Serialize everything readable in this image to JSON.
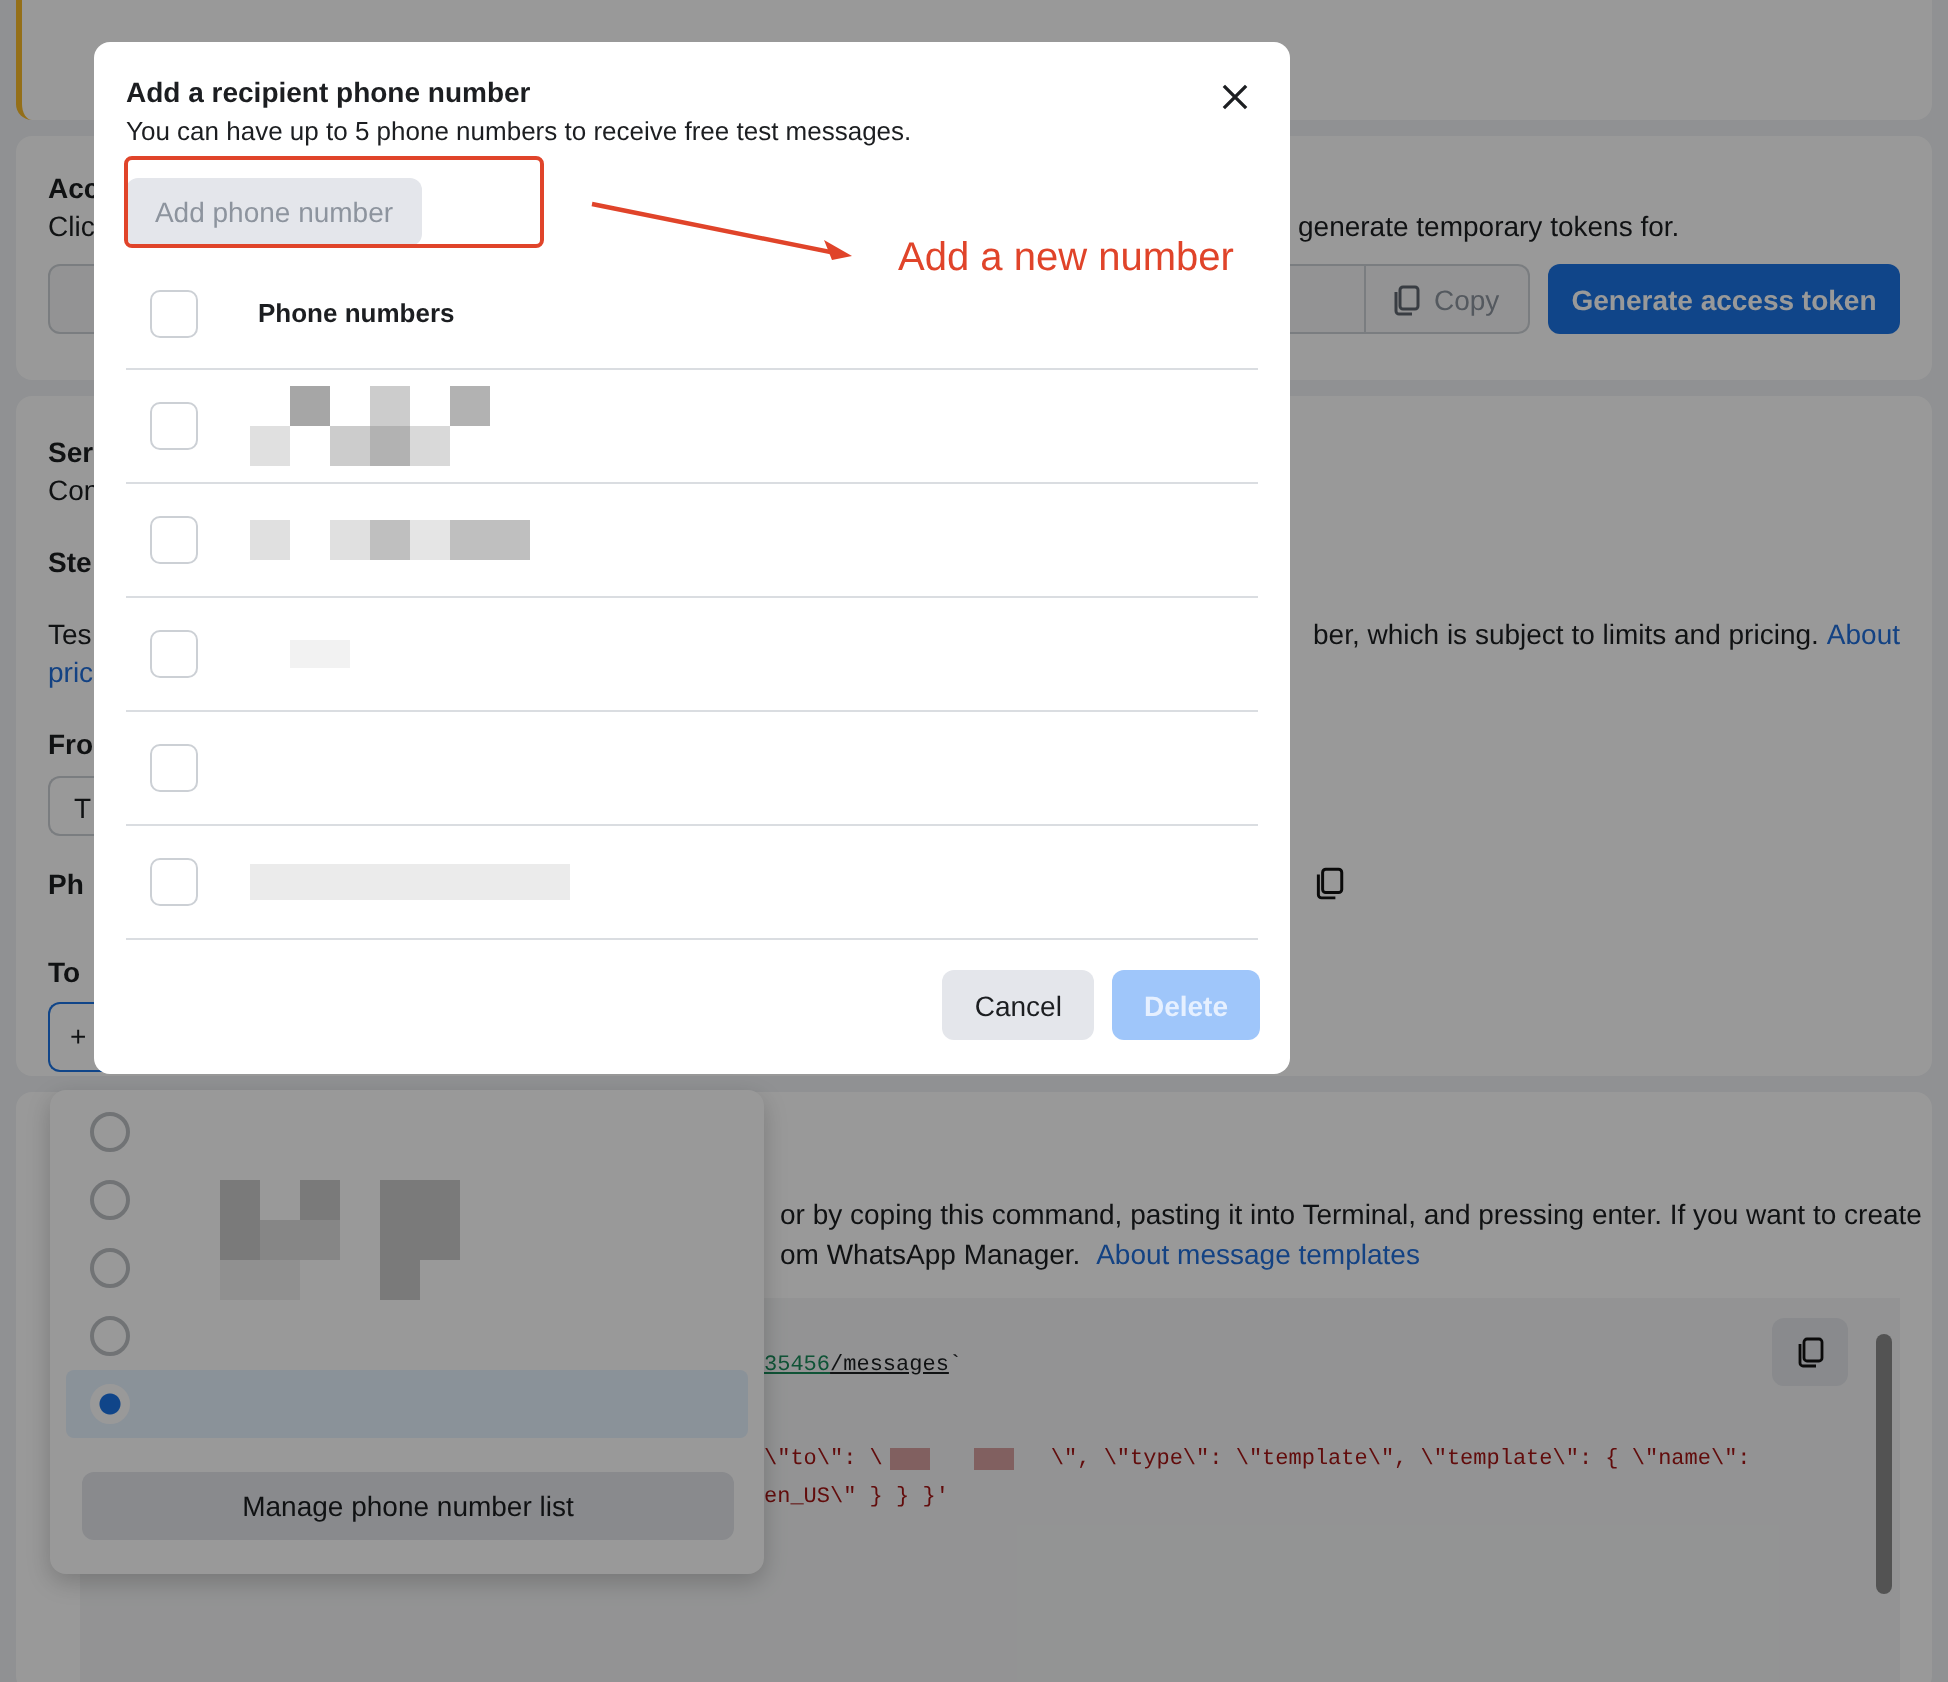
{
  "access_card": {
    "title": "Acc",
    "description_start": "Clic",
    "description_end": "generate temporary tokens for.",
    "copy_button": "Copy",
    "generate_button": "Generate access token"
  },
  "send_card": {
    "title": "Ser",
    "subtitle": "Con",
    "step": "Ste",
    "text_start": "Tes",
    "text_end": "ber, which is subject to limits and pricing.",
    "link": "About",
    "link_continued": "pric",
    "from_label": "Fro",
    "from_value": "T",
    "phone_label": "Ph",
    "to_label": "To",
    "to_value": "+"
  },
  "command_card": {
    "line_1": "or by coping this command, pasting it into Terminal, and pressing enter. If you want to create",
    "line_2": "om WhatsApp Manager.",
    "link": "About message templates",
    "code_lines": [
      {
        "parts": [
          {
            "kind": "url",
            "text": "35456"
          },
          {
            "kind": "path",
            "text": "/messages"
          },
          {
            "kind": "plain",
            "text": " `"
          }
        ]
      },
      {
        "parts": [
          {
            "kind": "string",
            "text": "\\\"to\\\": \\"
          },
          {
            "kind": "redaction"
          },
          {
            "kind": "redaction"
          },
          {
            "kind": "string",
            "text": "\\\", \\\"type\\\": \\\"template\\\", \\\"template\\\": { \\\"name\\\":"
          }
        ]
      },
      {
        "parts": [
          {
            "kind": "string",
            "text": "en_US\\\" } } }'"
          }
        ]
      }
    ]
  },
  "dropdown": {
    "options": [
      {
        "selected": false
      },
      {
        "selected": false
      },
      {
        "selected": false
      },
      {
        "selected": false
      },
      {
        "selected": true
      }
    ],
    "manage_button": "Manage phone number list"
  },
  "dialog": {
    "title": "Add a recipient phone number",
    "subtitle": "You can have up to 5 phone numbers to receive free test messages.",
    "add_button": "Add phone number",
    "column": "Phone numbers",
    "header_checked": false,
    "rows": [
      {
        "checked": false
      },
      {
        "checked": false
      },
      {
        "checked": false
      },
      {
        "checked": false
      },
      {
        "checked": false
      }
    ],
    "cancel_button": "Cancel",
    "delete_button": "Delete",
    "delete_disabled": true
  },
  "annotation": {
    "text": "Add a new number"
  }
}
